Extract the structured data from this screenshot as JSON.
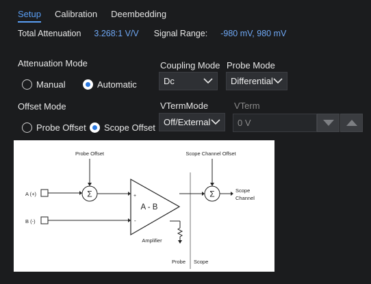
{
  "tabs": [
    {
      "label": "Setup",
      "active": true
    },
    {
      "label": "Calibration",
      "active": false
    },
    {
      "label": "Deembedding",
      "active": false
    }
  ],
  "info": {
    "total_attenuation_label": "Total Attenuation",
    "total_attenuation_value": "3.268:1 V/V",
    "signal_range_label": "Signal Range:",
    "signal_range_value": "-980 mV, 980 mV"
  },
  "attenuation_mode": {
    "label": "Attenuation Mode",
    "options": [
      "Manual",
      "Automatic"
    ],
    "selected": "Automatic"
  },
  "offset_mode": {
    "label": "Offset Mode",
    "options": [
      "Probe Offset",
      "Scope Offset"
    ],
    "selected": "Scope Offset"
  },
  "coupling_mode": {
    "label": "Coupling Mode",
    "value": "Dc"
  },
  "probe_mode": {
    "label": "Probe Mode",
    "value": "Differential"
  },
  "vterm_mode": {
    "label": "VTermMode",
    "value": "Off/External"
  },
  "vterm": {
    "label": "VTerm",
    "value": "0 V"
  },
  "diagram": {
    "probe_offset": "Probe Offset",
    "scope_channel_offset": "Scope Channel Offset",
    "input_a": "A (+)",
    "input_b": "B (-)",
    "amp_label": "A - B",
    "plus": "+",
    "minus": "-",
    "amplifier": "Amplifier",
    "sigma": "Σ",
    "scope_channel_line1": "Scope",
    "scope_channel_line2": "Channel",
    "probe": "Probe",
    "scope": "Scope"
  },
  "colors": {
    "accent": "#5a9ff5",
    "radio_selected": "#2b79e0",
    "background": "#1b1c1e"
  }
}
